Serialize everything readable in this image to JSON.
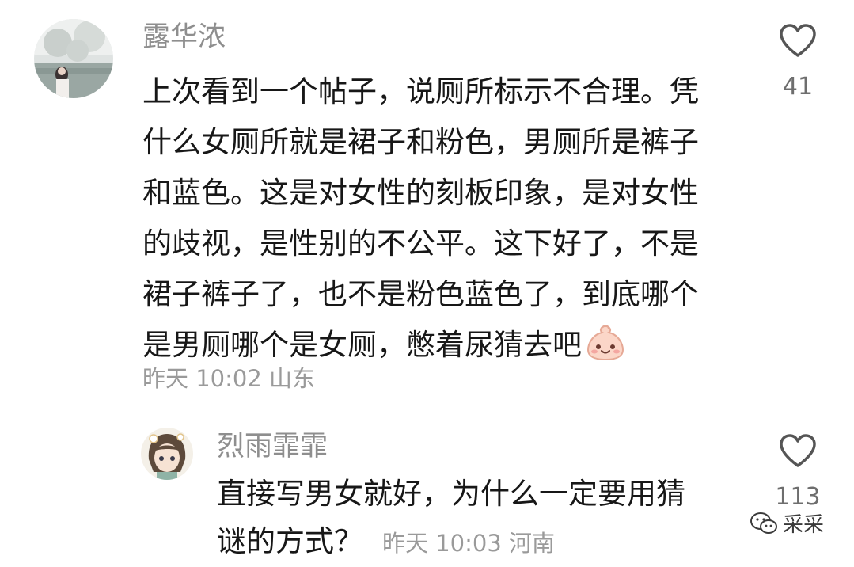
{
  "comments": [
    {
      "username": "露华浓",
      "lines": [
        "上次看到一个帖子，说厕所标示不合理。凭",
        "什么女厕所就是裙子和粉色，男厕所是裤子",
        "和蓝色。这是对女性的刻板印象，是对女性",
        "的歧视，是性别的不公平。这下好了，不是",
        "裙子裤子了，也不是粉色蓝色了，到底哪个",
        "是男厕哪个是女厕，憋着尿猜去吧"
      ],
      "emoji": "smiling-dumpling-emoji",
      "meta": "昨天 10:02 山东",
      "likes": "41"
    },
    {
      "username": "烈雨霏霏",
      "lines": [
        "直接写男女就好，为什么一定要用猜",
        "谜的方式？"
      ],
      "meta": "昨天 10:03 河南",
      "likes": "113"
    }
  ],
  "watermark": {
    "icon": "wechat-icon",
    "text": "采采"
  }
}
